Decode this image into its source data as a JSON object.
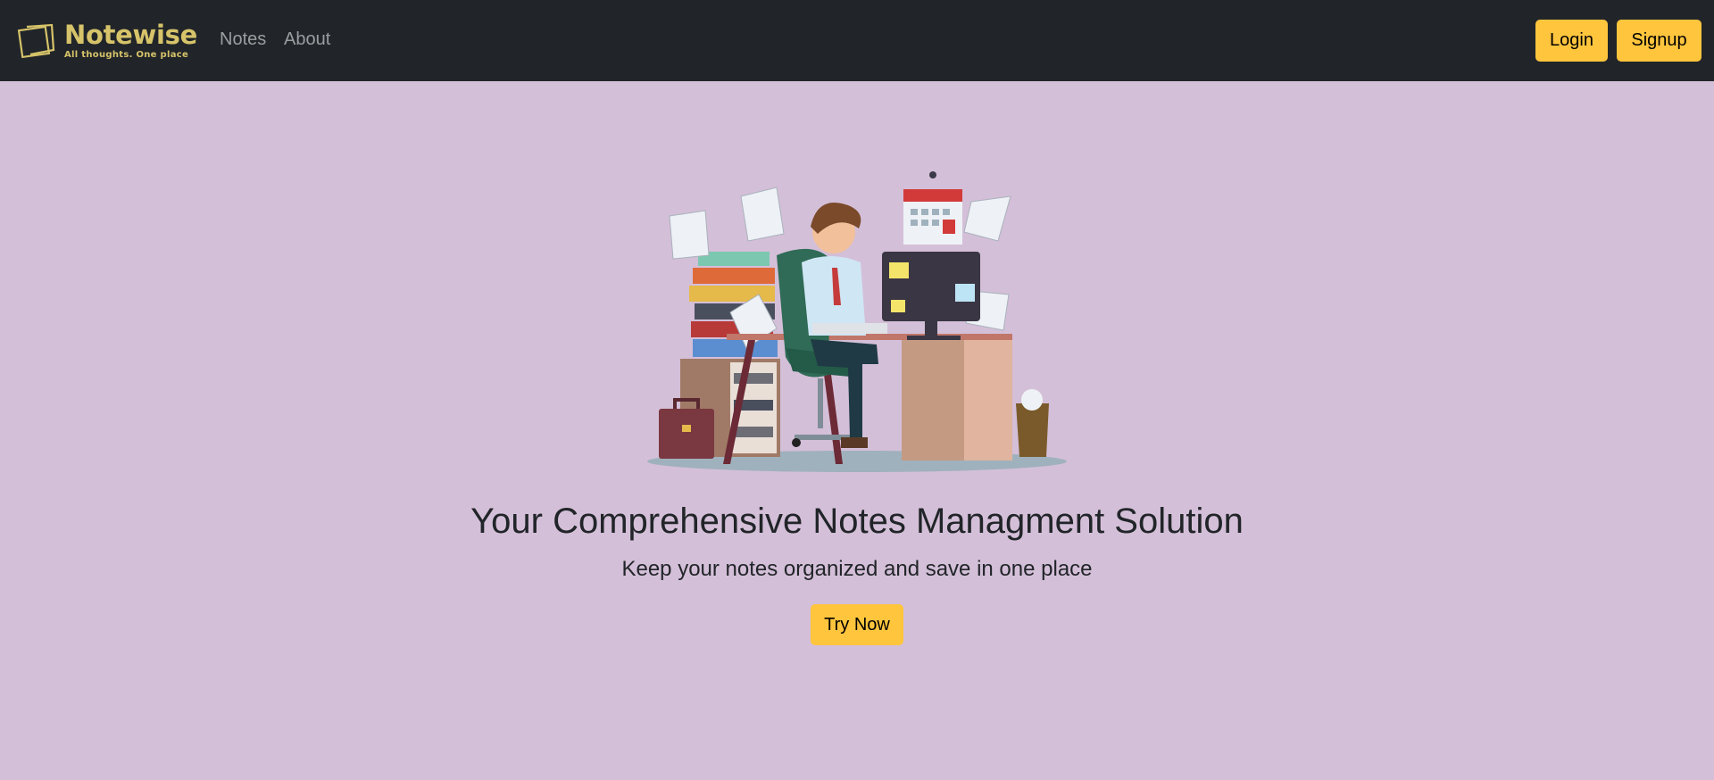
{
  "navbar": {
    "brand_name": "Notewise",
    "brand_tagline": "All thoughts. One place",
    "links": [
      "Notes",
      "About"
    ],
    "login_label": "Login",
    "signup_label": "Signup"
  },
  "hero": {
    "illustration": "overworked-office-worker-illustration",
    "title": "Your Comprehensive Notes Managment Solution",
    "subtitle": "Keep your notes organized and save in one place",
    "cta_label": "Try Now"
  },
  "colors": {
    "navbar_bg": "#212529",
    "page_bg": "#d4bfd8",
    "brand": "#d6c36a",
    "accent": "#ffc53d"
  }
}
